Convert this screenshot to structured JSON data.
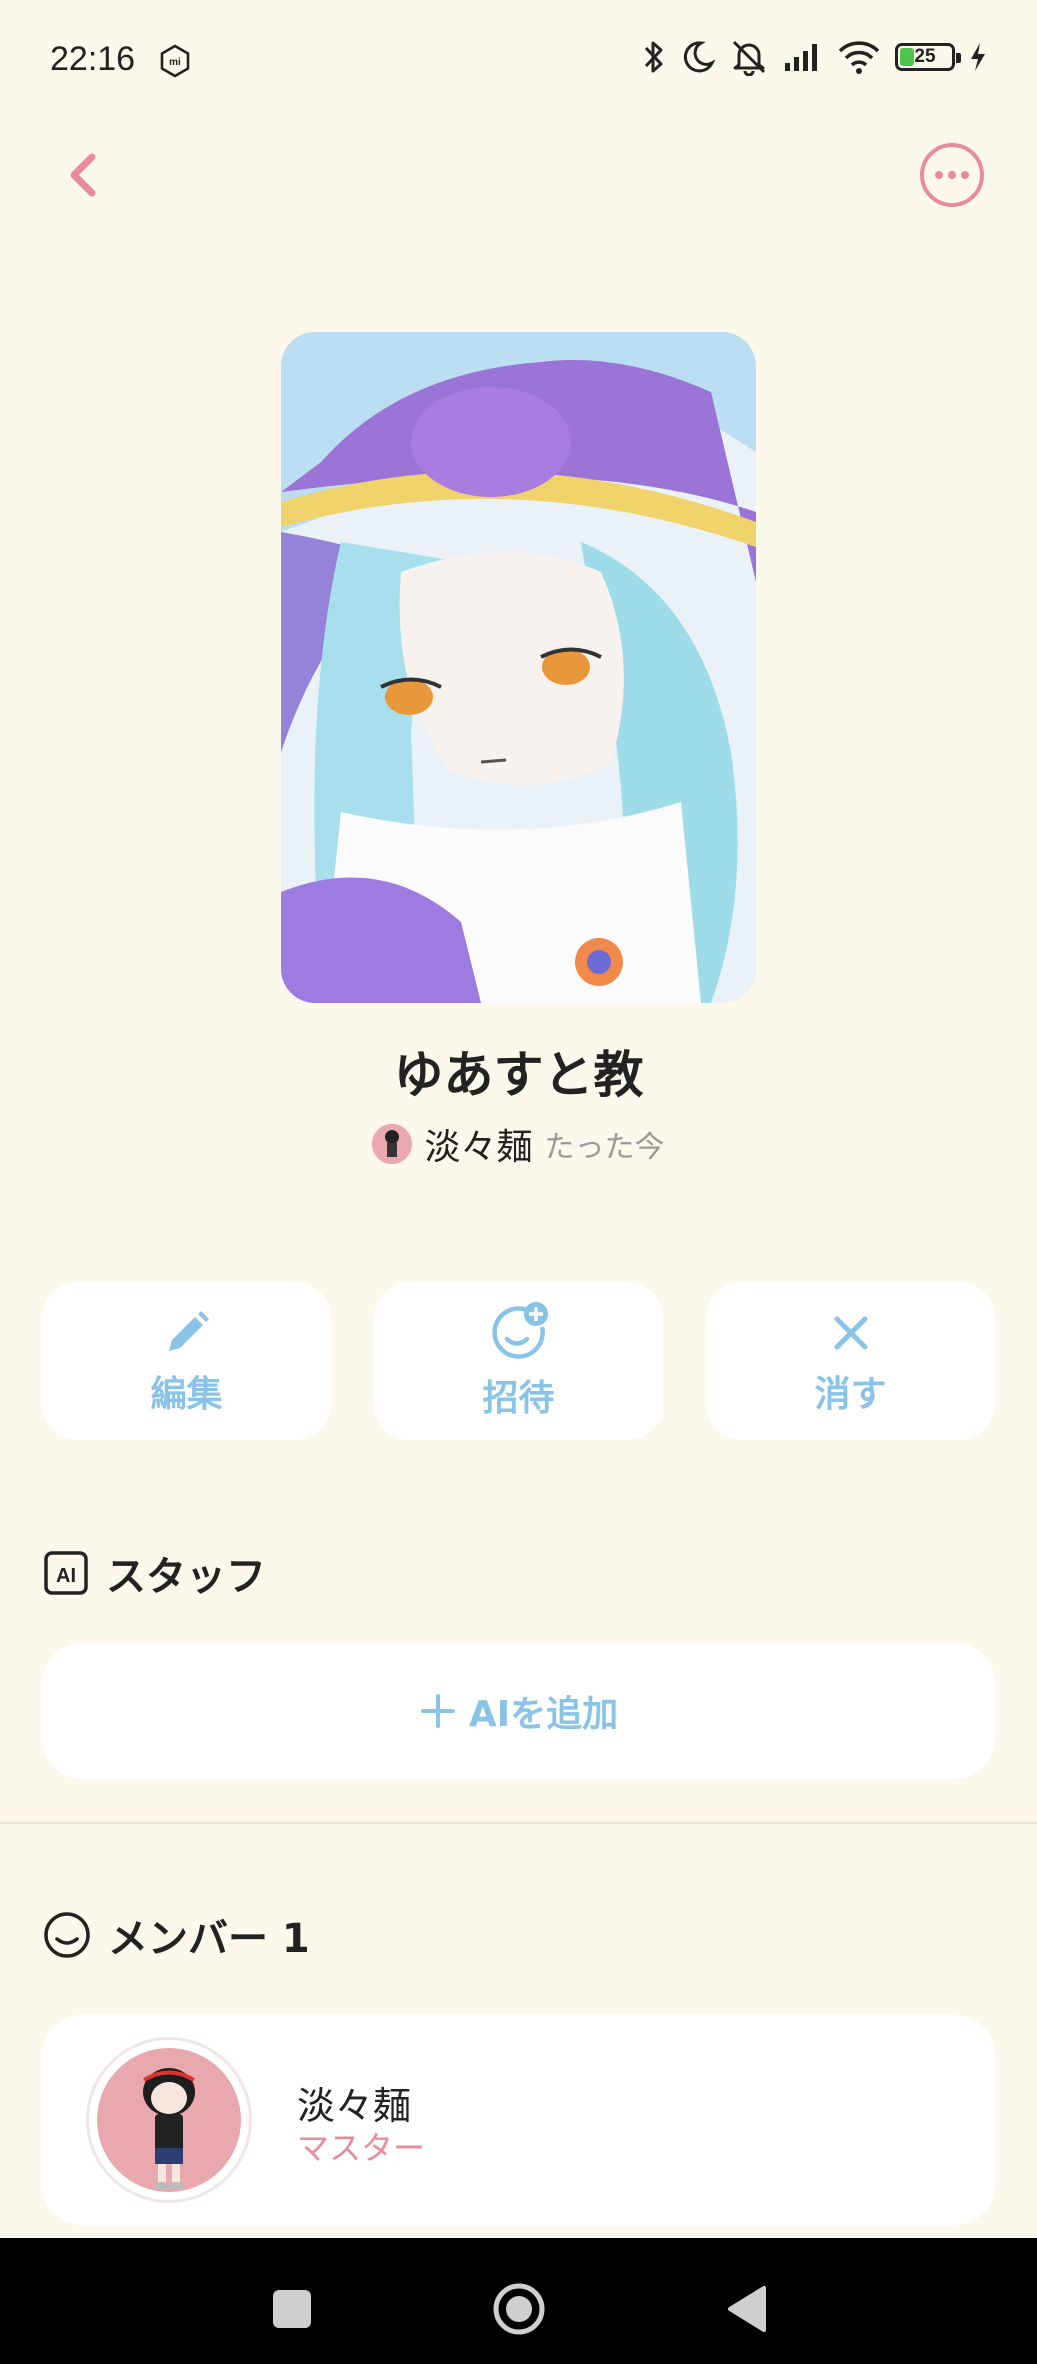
{
  "status_bar": {
    "time": "22:16",
    "battery_level": "25",
    "battery_fraction": 0.25,
    "icons": [
      "mi-icon",
      "bluetooth-icon",
      "moon-icon",
      "bell-muted-icon",
      "signal-icon",
      "wifi-icon",
      "battery-icon",
      "charging-icon"
    ]
  },
  "header": {
    "back_icon": "chevron-left-icon",
    "more_icon": "more-dots-icon",
    "accent_color": "#e88c9b"
  },
  "group": {
    "title": "ゆあすと教",
    "owner_name": "淡々麺",
    "time_ago": "たった今"
  },
  "actions": [
    {
      "label": "編集",
      "icon": "pencil-icon"
    },
    {
      "label": "招待",
      "icon": "invite-smile-icon"
    },
    {
      "label": "消す",
      "icon": "close-icon"
    }
  ],
  "staff": {
    "title": "スタッフ",
    "icon": "ai-icon",
    "add_label": "AIを追加"
  },
  "members": {
    "title": "メンバー 1",
    "icon": "smile-icon",
    "items": [
      {
        "name": "淡々麺",
        "role": "マスター"
      }
    ]
  },
  "colors": {
    "background": "#fdf8ec",
    "action_blue": "#89c3e6",
    "role_pink": "#e88c9b"
  }
}
